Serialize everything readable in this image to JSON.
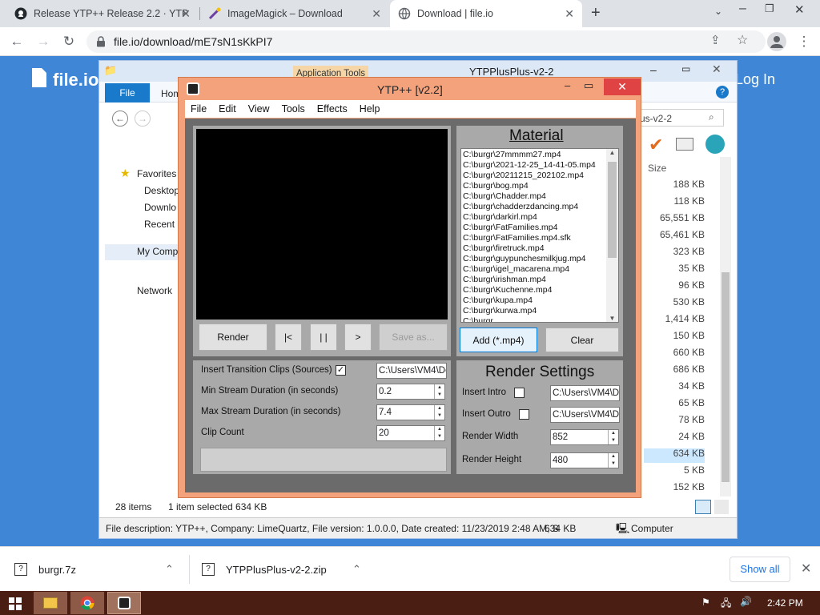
{
  "browser": {
    "tabs": [
      {
        "title": "Release YTP++ Release 2.2 · YTP",
        "icon": "github-icon"
      },
      {
        "title": "ImageMagick – Download",
        "icon": "wand-icon"
      },
      {
        "title": "Download | file.io",
        "icon": "globe-icon"
      }
    ],
    "new_tab": "+",
    "url": "file.io/download/mE7sN1sKkPI7"
  },
  "site": {
    "brand": "file.io",
    "login": "Log In"
  },
  "explorer": {
    "title": "YTPPlusPlus-v2-2",
    "context_tab": "Application Tools",
    "file_tab": "File",
    "home_tab": "Hom",
    "search_text": "us-v2-2",
    "nav": [
      "Favorites",
      "Desktop",
      "Downlo",
      "Recent p",
      "My Comp",
      "Network"
    ],
    "size_header": "Size",
    "sizes": [
      "188 KB",
      "118 KB",
      "65,551 KB",
      "65,461 KB",
      "323 KB",
      "35 KB",
      "96 KB",
      "530 KB",
      "1,414 KB",
      "150 KB",
      "660 KB",
      "686 KB",
      "34 KB",
      "65 KB",
      "78 KB",
      "24 KB",
      "634 KB",
      "5 KB",
      "152 KB"
    ],
    "item_count": "28 items",
    "selected": "1 item selected  634 KB",
    "details": "File description: YTP++, Company: LimeQuartz, File version: 1.0.0.0, Date created: 11/23/2019 2:48 AM, S",
    "details_size": "634 KB",
    "location": "Computer"
  },
  "ytp": {
    "title": "YTP++ [v2.2]",
    "menu": [
      "File",
      "Edit",
      "View",
      "Tools",
      "Effects",
      "Help"
    ],
    "buttons": {
      "render": "Render",
      "prev": "|<",
      "pause": "| |",
      "next": ">",
      "save": "Save as..."
    },
    "material": {
      "heading": "Material",
      "items": [
        "C:\\burgr\\27mmmm27.mp4",
        "C:\\burgr\\2021-12-25_14-41-05.mp4",
        "C:\\burgr\\20211215_202102.mp4",
        "C:\\burgr\\bog.mp4",
        "C:\\burgr\\Chadder.mp4",
        "C:\\burgr\\chadderzdancing.mp4",
        "C:\\burgr\\darkirl.mp4",
        "C:\\burgr\\FatFamilies.mp4",
        "C:\\burgr\\FatFamilies.mp4.sfk",
        "C:\\burgr\\firetruck.mp4",
        "C:\\burgr\\guypunchesmilkjug.mp4",
        "C:\\burgr\\igel_macarena.mp4",
        "C:\\burgr\\irishman.mp4",
        "C:\\burgr\\Kuchenne.mp4",
        "C:\\burgr\\kupa.mp4",
        "C:\\burgr\\kurwa.mp4",
        "C:\\burgr"
      ],
      "add": "Add (*.mp4)",
      "clear": "Clear"
    },
    "options": {
      "transition_label": "Insert Transition Clips (Sources)",
      "transition_path": "C:\\Users\\VM4\\Do",
      "min_label": "Min Stream Duration (in seconds)",
      "min_value": "0.2",
      "max_label": "Max Stream Duration (in seconds)",
      "max_value": "7.4",
      "clip_label": "Clip Count",
      "clip_value": "20"
    },
    "render": {
      "heading": "Render Settings",
      "intro_label": "Insert Intro",
      "intro_path": "C:\\Users\\VM4\\Do",
      "outro_label": "Insert Outro",
      "outro_path": "C:\\Users\\VM4\\Do",
      "width_label": "Render Width",
      "width_value": "852",
      "height_label": "Render Height",
      "height_value": "480"
    }
  },
  "downloads": {
    "items": [
      "burgr.7z",
      "YTPPlusPlus-v2-2.zip"
    ],
    "show_all": "Show all"
  },
  "taskbar": {
    "time": "2:42 PM"
  }
}
